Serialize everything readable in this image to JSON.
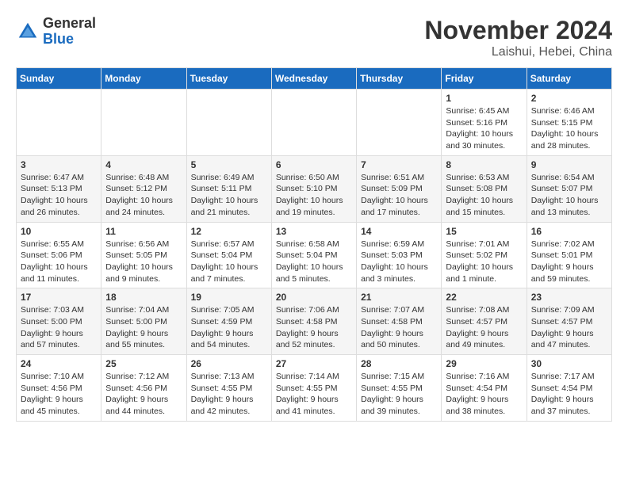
{
  "header": {
    "logo_line1": "General",
    "logo_line2": "Blue",
    "month": "November 2024",
    "location": "Laishui, Hebei, China"
  },
  "weekdays": [
    "Sunday",
    "Monday",
    "Tuesday",
    "Wednesday",
    "Thursday",
    "Friday",
    "Saturday"
  ],
  "weeks": [
    [
      {
        "day": "",
        "info": ""
      },
      {
        "day": "",
        "info": ""
      },
      {
        "day": "",
        "info": ""
      },
      {
        "day": "",
        "info": ""
      },
      {
        "day": "",
        "info": ""
      },
      {
        "day": "1",
        "info": "Sunrise: 6:45 AM\nSunset: 5:16 PM\nDaylight: 10 hours and 30 minutes."
      },
      {
        "day": "2",
        "info": "Sunrise: 6:46 AM\nSunset: 5:15 PM\nDaylight: 10 hours and 28 minutes."
      }
    ],
    [
      {
        "day": "3",
        "info": "Sunrise: 6:47 AM\nSunset: 5:13 PM\nDaylight: 10 hours and 26 minutes."
      },
      {
        "day": "4",
        "info": "Sunrise: 6:48 AM\nSunset: 5:12 PM\nDaylight: 10 hours and 24 minutes."
      },
      {
        "day": "5",
        "info": "Sunrise: 6:49 AM\nSunset: 5:11 PM\nDaylight: 10 hours and 21 minutes."
      },
      {
        "day": "6",
        "info": "Sunrise: 6:50 AM\nSunset: 5:10 PM\nDaylight: 10 hours and 19 minutes."
      },
      {
        "day": "7",
        "info": "Sunrise: 6:51 AM\nSunset: 5:09 PM\nDaylight: 10 hours and 17 minutes."
      },
      {
        "day": "8",
        "info": "Sunrise: 6:53 AM\nSunset: 5:08 PM\nDaylight: 10 hours and 15 minutes."
      },
      {
        "day": "9",
        "info": "Sunrise: 6:54 AM\nSunset: 5:07 PM\nDaylight: 10 hours and 13 minutes."
      }
    ],
    [
      {
        "day": "10",
        "info": "Sunrise: 6:55 AM\nSunset: 5:06 PM\nDaylight: 10 hours and 11 minutes."
      },
      {
        "day": "11",
        "info": "Sunrise: 6:56 AM\nSunset: 5:05 PM\nDaylight: 10 hours and 9 minutes."
      },
      {
        "day": "12",
        "info": "Sunrise: 6:57 AM\nSunset: 5:04 PM\nDaylight: 10 hours and 7 minutes."
      },
      {
        "day": "13",
        "info": "Sunrise: 6:58 AM\nSunset: 5:04 PM\nDaylight: 10 hours and 5 minutes."
      },
      {
        "day": "14",
        "info": "Sunrise: 6:59 AM\nSunset: 5:03 PM\nDaylight: 10 hours and 3 minutes."
      },
      {
        "day": "15",
        "info": "Sunrise: 7:01 AM\nSunset: 5:02 PM\nDaylight: 10 hours and 1 minute."
      },
      {
        "day": "16",
        "info": "Sunrise: 7:02 AM\nSunset: 5:01 PM\nDaylight: 9 hours and 59 minutes."
      }
    ],
    [
      {
        "day": "17",
        "info": "Sunrise: 7:03 AM\nSunset: 5:00 PM\nDaylight: 9 hours and 57 minutes."
      },
      {
        "day": "18",
        "info": "Sunrise: 7:04 AM\nSunset: 5:00 PM\nDaylight: 9 hours and 55 minutes."
      },
      {
        "day": "19",
        "info": "Sunrise: 7:05 AM\nSunset: 4:59 PM\nDaylight: 9 hours and 54 minutes."
      },
      {
        "day": "20",
        "info": "Sunrise: 7:06 AM\nSunset: 4:58 PM\nDaylight: 9 hours and 52 minutes."
      },
      {
        "day": "21",
        "info": "Sunrise: 7:07 AM\nSunset: 4:58 PM\nDaylight: 9 hours and 50 minutes."
      },
      {
        "day": "22",
        "info": "Sunrise: 7:08 AM\nSunset: 4:57 PM\nDaylight: 9 hours and 49 minutes."
      },
      {
        "day": "23",
        "info": "Sunrise: 7:09 AM\nSunset: 4:57 PM\nDaylight: 9 hours and 47 minutes."
      }
    ],
    [
      {
        "day": "24",
        "info": "Sunrise: 7:10 AM\nSunset: 4:56 PM\nDaylight: 9 hours and 45 minutes."
      },
      {
        "day": "25",
        "info": "Sunrise: 7:12 AM\nSunset: 4:56 PM\nDaylight: 9 hours and 44 minutes."
      },
      {
        "day": "26",
        "info": "Sunrise: 7:13 AM\nSunset: 4:55 PM\nDaylight: 9 hours and 42 minutes."
      },
      {
        "day": "27",
        "info": "Sunrise: 7:14 AM\nSunset: 4:55 PM\nDaylight: 9 hours and 41 minutes."
      },
      {
        "day": "28",
        "info": "Sunrise: 7:15 AM\nSunset: 4:55 PM\nDaylight: 9 hours and 39 minutes."
      },
      {
        "day": "29",
        "info": "Sunrise: 7:16 AM\nSunset: 4:54 PM\nDaylight: 9 hours and 38 minutes."
      },
      {
        "day": "30",
        "info": "Sunrise: 7:17 AM\nSunset: 4:54 PM\nDaylight: 9 hours and 37 minutes."
      }
    ]
  ]
}
